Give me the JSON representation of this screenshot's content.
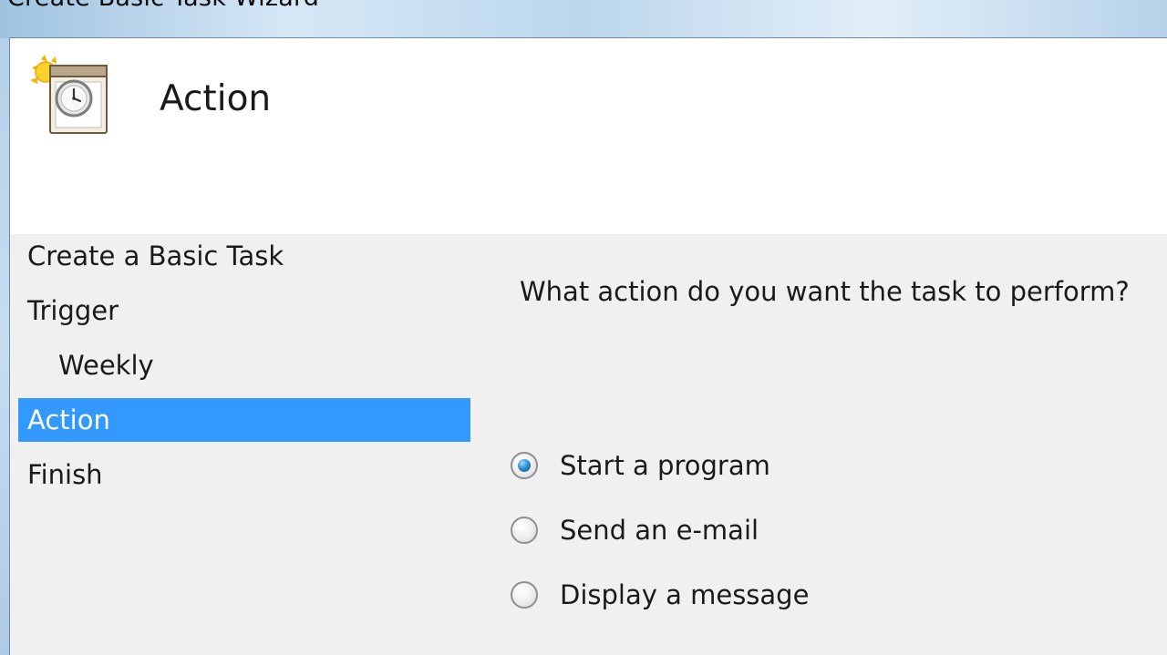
{
  "window": {
    "title": "Create Basic Task Wizard"
  },
  "header": {
    "title": "Action",
    "icon": "task-scheduler-clock-icon"
  },
  "steps": [
    {
      "label": "Create a Basic Task",
      "selected": false,
      "indent": false
    },
    {
      "label": "Trigger",
      "selected": false,
      "indent": false
    },
    {
      "label": "Weekly",
      "selected": false,
      "indent": true
    },
    {
      "label": "Action",
      "selected": true,
      "indent": false
    },
    {
      "label": "Finish",
      "selected": false,
      "indent": false
    }
  ],
  "main": {
    "question": "What action do you want the task to perform?",
    "options": [
      {
        "label": "Start a program",
        "checked": true
      },
      {
        "label": "Send an e-mail",
        "checked": false
      },
      {
        "label": "Display a message",
        "checked": false
      }
    ]
  },
  "colors": {
    "selection": "#3399ff",
    "dialog_background": "#f0f0f0",
    "header_background": "#ffffff"
  }
}
